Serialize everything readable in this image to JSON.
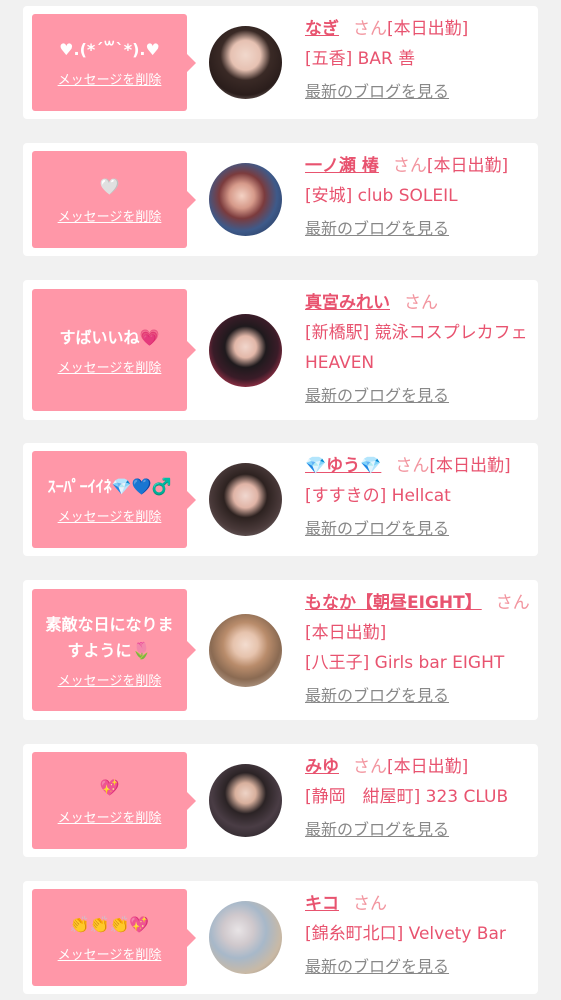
{
  "colors": {
    "accent": "#e8536f",
    "bubble": "#ff97a8",
    "background": "#f1f1f1"
  },
  "delete_label": "メッセージを削除",
  "blog_label": "最新のブログを見る",
  "cards": [
    {
      "message": "♥.(*´꒳`*).♥",
      "name": "なぎ",
      "honorific": "さん",
      "status": "[本日出勤]",
      "shop": "[五香] BAR 善"
    },
    {
      "message": "🤍",
      "name": "一ノ瀬 椿",
      "honorific": "さん",
      "status": "[本日出勤]",
      "shop": "[安城] club SOLEIL"
    },
    {
      "message": "すばいいね💗",
      "name": "真宮みれい",
      "honorific": "さん",
      "status": "",
      "shop": "[新橋駅] 競泳コスプレカフェ　HEAVEN"
    },
    {
      "message": "ｽｰﾊﾟｰｲｲﾈ💎💙♂️",
      "name": "💎ゆう💎",
      "honorific": "さん",
      "status": "[本日出勤]",
      "shop": "[すすきの] Hellcat"
    },
    {
      "message": "素敵な日になりますように🌷",
      "name": "もなか【朝昼EIGHT】",
      "honorific": "さん",
      "status": "[本日出勤]",
      "shop": "[八王子] Girls bar EIGHT"
    },
    {
      "message": "💖",
      "name": "みゆ",
      "honorific": "さん",
      "status": "[本日出勤]",
      "shop": "[静岡　紺屋町] 323 CLUB"
    },
    {
      "message": "👏👏👏💖",
      "name": "キコ",
      "honorific": "さん",
      "status": "",
      "shop": "[錦糸町北口] Velvety Bar"
    }
  ]
}
